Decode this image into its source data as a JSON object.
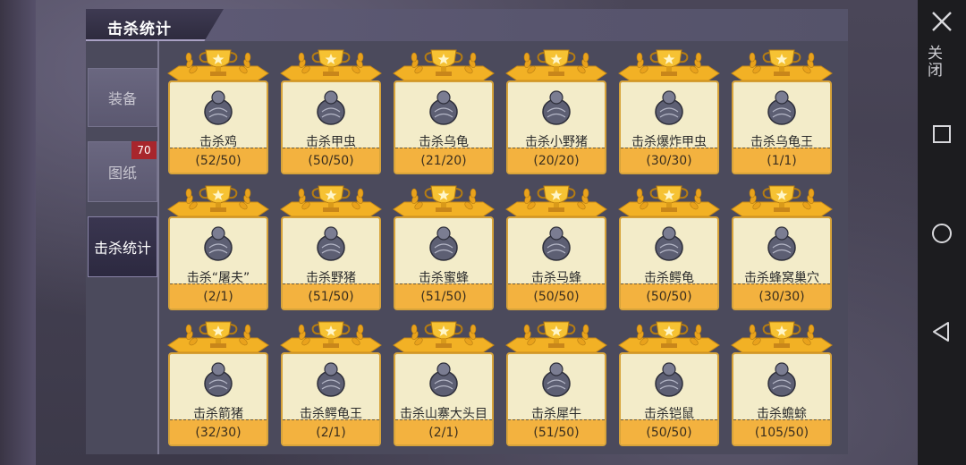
{
  "header": {
    "title": "击杀统计"
  },
  "sidebar": {
    "tabs": [
      {
        "label": "装备"
      },
      {
        "label": "图纸",
        "badge": "70"
      },
      {
        "label": "击杀统计",
        "active": true
      }
    ]
  },
  "cards": [
    {
      "name": "击杀鸡",
      "progress": "(52/50)",
      "icon": "chicken-icon"
    },
    {
      "name": "击杀甲虫",
      "progress": "(50/50)",
      "icon": "beetle-icon"
    },
    {
      "name": "击杀乌龟",
      "progress": "(21/20)",
      "icon": "turtle-icon"
    },
    {
      "name": "击杀小野猪",
      "progress": "(20/20)",
      "icon": "piglet-icon"
    },
    {
      "name": "击杀爆炸甲虫",
      "progress": "(30/30)",
      "icon": "explosive-beetle-icon"
    },
    {
      "name": "击杀乌龟王",
      "progress": "(1/1)",
      "icon": "turtle-king-icon"
    },
    {
      "name": "击杀“屠夫”",
      "progress": "(2/1)",
      "icon": "butcher-icon"
    },
    {
      "name": "击杀野猪",
      "progress": "(51/50)",
      "icon": "boar-icon"
    },
    {
      "name": "击杀蜜蜂",
      "progress": "(51/50)",
      "icon": "bee-icon"
    },
    {
      "name": "击杀马蜂",
      "progress": "(50/50)",
      "icon": "wasp-icon"
    },
    {
      "name": "击杀鳄龟",
      "progress": "(50/50)",
      "icon": "snapping-turtle-icon"
    },
    {
      "name": "击杀蜂窝巢穴",
      "progress": "(30/30)",
      "icon": "hive-icon"
    },
    {
      "name": "击杀箭猪",
      "progress": "(32/30)",
      "icon": "porcupine-icon"
    },
    {
      "name": "击杀鳄龟王",
      "progress": "(2/1)",
      "icon": "snapping-turtle-king-icon"
    },
    {
      "name": "击杀山寨大头目",
      "progress": "(2/1)",
      "icon": "bandit-chief-icon"
    },
    {
      "name": "击杀犀牛",
      "progress": "(51/50)",
      "icon": "rhino-icon"
    },
    {
      "name": "击杀铠鼠",
      "progress": "(50/50)",
      "icon": "armadillo-icon"
    },
    {
      "name": "击杀蟾蜍",
      "progress": "(105/50)",
      "icon": "toad-icon"
    }
  ],
  "navbar": {
    "close_label": "关闭"
  },
  "colors": {
    "card_bg": "#f3ecc9",
    "card_footer": "#f3b23f",
    "trophy_gold": "#f2b125",
    "badge_red": "#a8262c"
  }
}
